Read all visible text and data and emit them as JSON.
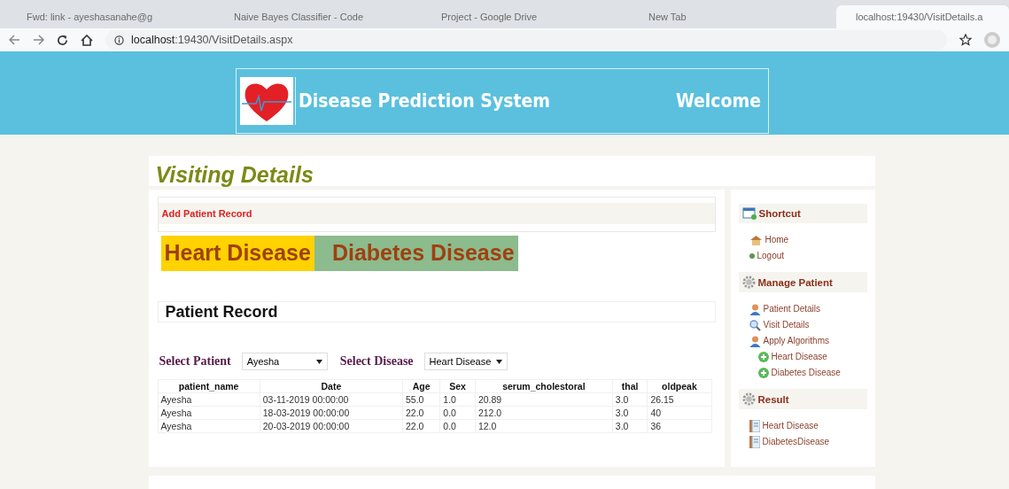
{
  "browser": {
    "tabs": [
      {
        "label": "Fwd: link - ayeshasanahe@g",
        "selected": false
      },
      {
        "label": "Naive Bayes Classifier - Code",
        "selected": false
      },
      {
        "label": "Project - Google Drive",
        "selected": false
      },
      {
        "label": "New Tab",
        "selected": false
      },
      {
        "label": "localhost:19430/VisitDetails.a",
        "selected": true
      }
    ],
    "address_host": "localhost",
    "address_rest": ":19430/VisitDetails.aspx"
  },
  "header": {
    "title": "Disease Prediction System",
    "welcome": "Welcome"
  },
  "page_title": "Visiting Details",
  "add_link": "Add Patient Record",
  "disease_tabs": [
    {
      "label": "Heart Disease",
      "color": "#ffd200"
    },
    {
      "label": "Diabetes Disease",
      "color": "#8cbb8e"
    }
  ],
  "section_title": "Patient Record",
  "filters": [
    {
      "label": "Select Patient",
      "value": "Ayesha"
    },
    {
      "label": "Select Disease",
      "value": "Heart Disease"
    }
  ],
  "table": {
    "columns": [
      "patient_name",
      "Date",
      "Age",
      "Sex",
      "serum_cholestoral",
      "thal",
      "oldpeak"
    ],
    "rows": [
      [
        "Ayesha",
        "03-11-2019 00:00:00",
        "55.0",
        "1.0",
        "20.89",
        "3.0",
        "26.15"
      ],
      [
        "Ayesha",
        "18-03-2019 00:00:00",
        "22.0",
        "0.0",
        "212.0",
        "3.0",
        "40"
      ],
      [
        "Ayesha",
        "20-03-2019 00:00:00",
        "22.0",
        "0.0",
        "12.0",
        "3.0",
        "36"
      ]
    ]
  },
  "sidebar": [
    {
      "title": "Shortcut",
      "kind": "window",
      "items": [
        {
          "label": "Home",
          "kind": "home"
        },
        {
          "label": "Logout",
          "kind": "dot"
        }
      ]
    },
    {
      "title": "Manage Patient",
      "kind": "gear",
      "items": [
        {
          "label": "Patient Details",
          "kind": "person"
        },
        {
          "label": "Visit Details",
          "kind": "search"
        },
        {
          "label": "Apply Algorithms",
          "kind": "person",
          "children": [
            {
              "label": "Heart Disease",
              "kind": "plus"
            },
            {
              "label": "Diabetes Disease",
              "kind": "plus"
            }
          ]
        }
      ]
    },
    {
      "title": "Result",
      "kind": "gear",
      "items": [
        {
          "label": "Heart Disease",
          "kind": "doc"
        },
        {
          "label": "DiabetesDisease",
          "kind": "doc"
        }
      ]
    }
  ]
}
